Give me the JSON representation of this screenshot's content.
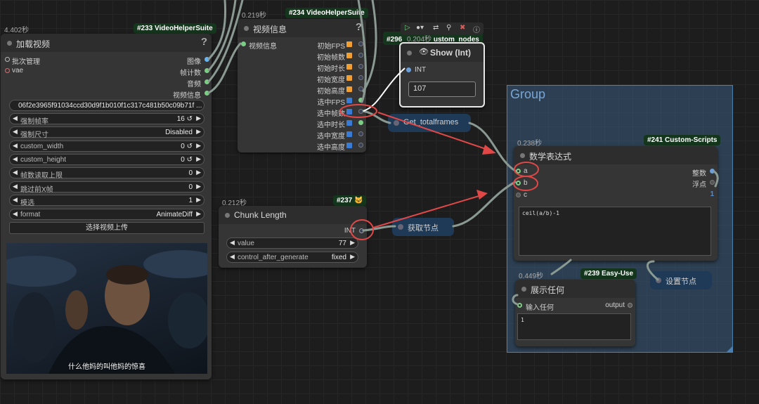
{
  "group": {
    "title": "Group"
  },
  "node233": {
    "time": "4.402秒",
    "id": "#233 VideoHelperSuite",
    "title": "加载视频",
    "help": "?",
    "inputs": [
      "批次管理",
      "vae"
    ],
    "outputs": [
      "图像",
      "帧计数",
      "音频",
      "视频信息"
    ],
    "filename": "06f2e3965f91034ccd30d9f1b010f1c317c481b50c09b71f ...",
    "widgets": [
      {
        "label": "强制帧率",
        "value": "16 ↺"
      },
      {
        "label": "强制尺寸",
        "value": "Disabled"
      },
      {
        "label": "custom_width",
        "value": "0 ↺"
      },
      {
        "label": "custom_height",
        "value": "0 ↺"
      },
      {
        "label": "帧数读取上限",
        "value": "0"
      },
      {
        "label": "跳过前X帧",
        "value": "0"
      },
      {
        "label": "模选",
        "value": "1"
      },
      {
        "label": "format",
        "value": "AnimateDiff"
      }
    ],
    "upload_label": "选择视频上传",
    "subtitle": "什么他妈的叫他妈的惊喜"
  },
  "node234": {
    "time": "0.219秒",
    "id": "#234 VideoHelperSuite",
    "title": "视频信息",
    "help": "?",
    "input": "视频信息",
    "outputs": [
      "初始FPS",
      "初始帧数",
      "初始时长",
      "初始宽度",
      "初始高度",
      "选中FPS",
      "选中帧数",
      "选中时长",
      "选中宽度",
      "选中高度"
    ]
  },
  "node296": {
    "time": "0.204秒",
    "id": "#296",
    "id_suffix": "ustom_nodes",
    "title": "Show (Int)",
    "input": "INT",
    "value": "107"
  },
  "node237": {
    "time": "0.212秒",
    "id": "#237 🐱",
    "title": "Chunk Length",
    "output": "INT",
    "widgets": [
      {
        "label": "value",
        "value": "77"
      },
      {
        "label": "control_after_generate",
        "value": "fixed"
      }
    ]
  },
  "node241": {
    "time": "0.238秒",
    "id": "#241 Custom-Scripts",
    "title": "数学表达式",
    "inputs": [
      "a",
      "b",
      "c"
    ],
    "outputs": [
      "整数",
      "浮点"
    ],
    "out_hint": "1",
    "expression": "ceil(a/b)-1"
  },
  "node239": {
    "time": "0.449秒",
    "id": "#239 Easy-Use",
    "title": "展示任何",
    "input": "输入任何",
    "output": "output",
    "line": "1"
  },
  "reroutes": {
    "get_totalframes": "Get_totalframes",
    "get_node": "获取节点",
    "set_node": "设置节点"
  },
  "colors": {
    "link": "#8a9a93",
    "annotation": "#e04848",
    "group": "#3a5c80"
  }
}
